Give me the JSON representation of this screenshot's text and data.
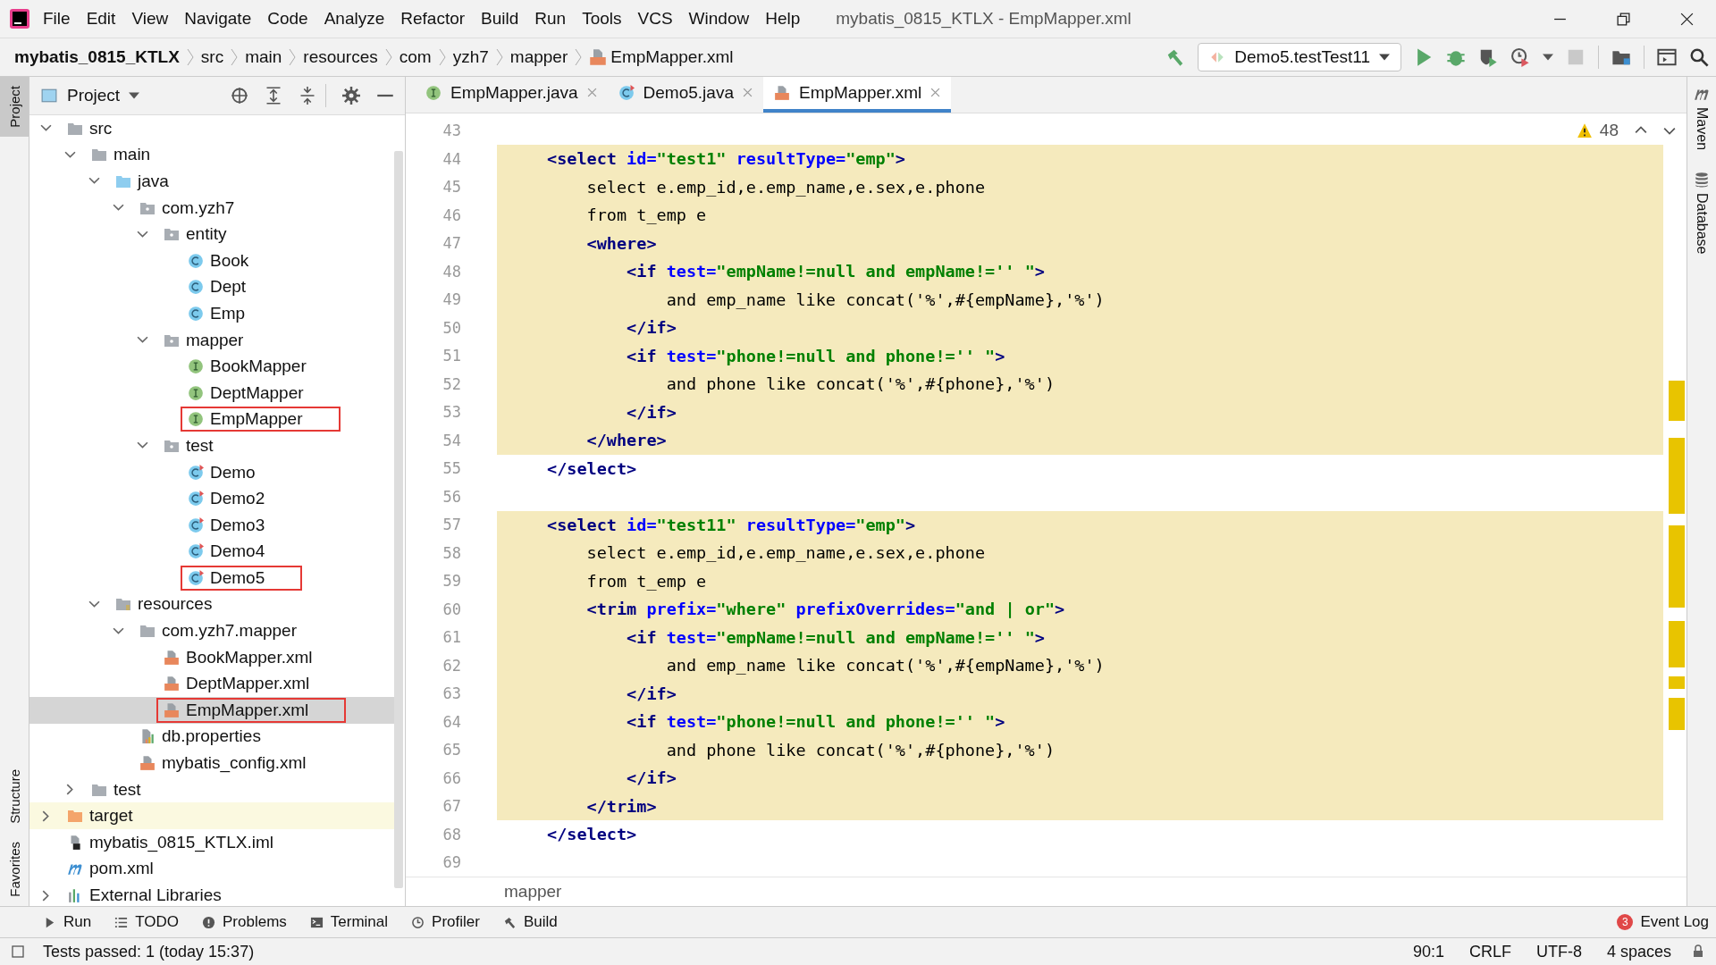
{
  "menu": [
    "File",
    "Edit",
    "View",
    "Navigate",
    "Code",
    "Analyze",
    "Refactor",
    "Build",
    "Run",
    "Tools",
    "VCS",
    "Window",
    "Help"
  ],
  "window": {
    "title": "mybatis_0815_KTLX - EmpMapper.xml"
  },
  "breadcrumbs": [
    {
      "label": "mybatis_0815_KTLX",
      "kind": "project"
    },
    {
      "label": "src",
      "kind": "dir"
    },
    {
      "label": "main",
      "kind": "dir"
    },
    {
      "label": "resources",
      "kind": "dir"
    },
    {
      "label": "com",
      "kind": "dir"
    },
    {
      "label": "yzh7",
      "kind": "dir"
    },
    {
      "label": "mapper",
      "kind": "dir"
    },
    {
      "label": "EmpMapper.xml",
      "kind": "xml"
    }
  ],
  "run_config": "Demo5.testTest11",
  "project_panel": {
    "title": "Project"
  },
  "tree": [
    {
      "label": "src",
      "kind": "folder",
      "expanded": true,
      "selected": false,
      "outlined": false,
      "children": [
        {
          "label": "main",
          "kind": "folder",
          "expanded": true,
          "selected": false,
          "outlined": false,
          "children": [
            {
              "label": "java",
              "kind": "source",
              "expanded": true,
              "selected": false,
              "outlined": false,
              "children": [
                {
                  "label": "com.yzh7",
                  "kind": "package",
                  "expanded": true,
                  "selected": false,
                  "outlined": false,
                  "children": [
                    {
                      "label": "entity",
                      "kind": "package",
                      "expanded": true,
                      "selected": false,
                      "outlined": false,
                      "children": [
                        {
                          "label": "Book",
                          "kind": "class",
                          "selected": false,
                          "outlined": false
                        },
                        {
                          "label": "Dept",
                          "kind": "class",
                          "selected": false,
                          "outlined": false
                        },
                        {
                          "label": "Emp",
                          "kind": "class",
                          "selected": false,
                          "outlined": false
                        }
                      ]
                    },
                    {
                      "label": "mapper",
                      "kind": "package",
                      "expanded": true,
                      "selected": false,
                      "outlined": false,
                      "children": [
                        {
                          "label": "BookMapper",
                          "kind": "interface",
                          "selected": false,
                          "outlined": false
                        },
                        {
                          "label": "DeptMapper",
                          "kind": "interface",
                          "selected": false,
                          "outlined": false
                        },
                        {
                          "label": "EmpMapper",
                          "kind": "interface",
                          "selected": false,
                          "outlined": true
                        }
                      ]
                    },
                    {
                      "label": "test",
                      "kind": "package",
                      "expanded": true,
                      "selected": false,
                      "outlined": false,
                      "children": [
                        {
                          "label": "Demo",
                          "kind": "testclass",
                          "selected": false,
                          "outlined": false
                        },
                        {
                          "label": "Demo2",
                          "kind": "testclass",
                          "selected": false,
                          "outlined": false
                        },
                        {
                          "label": "Demo3",
                          "kind": "testclass",
                          "selected": false,
                          "outlined": false
                        },
                        {
                          "label": "Demo4",
                          "kind": "testclass",
                          "selected": false,
                          "outlined": false
                        },
                        {
                          "label": "Demo5",
                          "kind": "testclass",
                          "selected": false,
                          "outlined": true
                        }
                      ]
                    }
                  ]
                }
              ]
            },
            {
              "label": "resources",
              "kind": "resources",
              "expanded": true,
              "selected": false,
              "outlined": false,
              "children": [
                {
                  "label": "com.yzh7.mapper",
                  "kind": "folder",
                  "expanded": true,
                  "selected": false,
                  "outlined": false,
                  "children": [
                    {
                      "label": "BookMapper.xml",
                      "kind": "xml",
                      "selected": false,
                      "outlined": false
                    },
                    {
                      "label": "DeptMapper.xml",
                      "kind": "xml",
                      "selected": false,
                      "outlined": false
                    },
                    {
                      "label": "EmpMapper.xml",
                      "kind": "xml",
                      "selected": true,
                      "outlined": true
                    }
                  ]
                },
                {
                  "label": "db.properties",
                  "kind": "properties",
                  "selected": false,
                  "outlined": false
                },
                {
                  "label": "mybatis_config.xml",
                  "kind": "xml",
                  "selected": false,
                  "outlined": false
                }
              ]
            }
          ]
        },
        {
          "label": "test",
          "kind": "folder",
          "expanded": false,
          "selected": false,
          "outlined": false
        }
      ]
    },
    {
      "label": "target",
      "kind": "excluded",
      "expanded": false,
      "selected": false,
      "outlined": false
    },
    {
      "label": "mybatis_0815_KTLX.iml",
      "kind": "iml",
      "selected": false,
      "outlined": false
    },
    {
      "label": "pom.xml",
      "kind": "maven",
      "selected": false,
      "outlined": false
    },
    {
      "label": "External Libraries",
      "kind": "libs",
      "expanded": false,
      "selected": false,
      "outlined": false
    }
  ],
  "tabs": [
    {
      "label": "EmpMapper.java",
      "kind": "interface",
      "selected": false
    },
    {
      "label": "Demo5.java",
      "kind": "testclass",
      "selected": false
    },
    {
      "label": "EmpMapper.xml",
      "kind": "xml",
      "selected": true
    }
  ],
  "warnings": "48",
  "code": [
    {
      "n": "43",
      "hl": false
    },
    {
      "n": "44",
      "hl": true,
      "t": [
        {
          "kind": "tag",
          "s": "<select"
        },
        {
          "kind": "attr",
          "s": " id="
        },
        {
          "kind": "str",
          "s": "\"test1\""
        },
        {
          "kind": "attr",
          "s": " resultType="
        },
        {
          "kind": "str",
          "s": "\"emp\""
        },
        {
          "kind": "tag",
          "s": ">"
        }
      ]
    },
    {
      "n": "45",
      "hl": true,
      "t": [
        {
          "kind": "text",
          "s": "    select e.emp_id,e.emp_name,e.sex,e.phone"
        }
      ]
    },
    {
      "n": "46",
      "hl": true,
      "t": [
        {
          "kind": "text",
          "s": "    from t_emp e"
        }
      ]
    },
    {
      "n": "47",
      "hl": true,
      "t": [
        {
          "kind": "tag",
          "s": "    <where>"
        }
      ]
    },
    {
      "n": "48",
      "hl": true,
      "t": [
        {
          "kind": "tag",
          "s": "        <if"
        },
        {
          "kind": "attr",
          "s": " test="
        },
        {
          "kind": "str",
          "s": "\"empName!=null and empName!='' \""
        },
        {
          "kind": "tag",
          "s": ">"
        }
      ]
    },
    {
      "n": "49",
      "hl": true,
      "t": [
        {
          "kind": "text",
          "s": "            and emp_name like concat('%',#{empName},'%')"
        }
      ]
    },
    {
      "n": "50",
      "hl": true,
      "t": [
        {
          "kind": "tag",
          "s": "        </if>"
        }
      ]
    },
    {
      "n": "51",
      "hl": true,
      "t": [
        {
          "kind": "tag",
          "s": "        <if"
        },
        {
          "kind": "attr",
          "s": " test="
        },
        {
          "kind": "str",
          "s": "\"phone!=null and phone!='' \""
        },
        {
          "kind": "tag",
          "s": ">"
        }
      ]
    },
    {
      "n": "52",
      "hl": true,
      "t": [
        {
          "kind": "text",
          "s": "            and phone like concat('%',#{phone},'%')"
        }
      ]
    },
    {
      "n": "53",
      "hl": true,
      "t": [
        {
          "kind": "tag",
          "s": "        </if>"
        }
      ]
    },
    {
      "n": "54",
      "hl": true,
      "t": [
        {
          "kind": "tag",
          "s": "    </where>"
        }
      ]
    },
    {
      "n": "55",
      "hl": false,
      "t": [
        {
          "kind": "tag",
          "s": "</select>"
        }
      ]
    },
    {
      "n": "56",
      "hl": false
    },
    {
      "n": "57",
      "hl": true,
      "t": [
        {
          "kind": "tag",
          "s": "<select"
        },
        {
          "kind": "attr",
          "s": " id="
        },
        {
          "kind": "str",
          "s": "\"test11\""
        },
        {
          "kind": "attr",
          "s": " resultType="
        },
        {
          "kind": "str",
          "s": "\"emp\""
        },
        {
          "kind": "tag",
          "s": ">"
        }
      ]
    },
    {
      "n": "58",
      "hl": true,
      "t": [
        {
          "kind": "text",
          "s": "    select e.emp_id,e.emp_name,e.sex,e.phone"
        }
      ]
    },
    {
      "n": "59",
      "hl": true,
      "t": [
        {
          "kind": "text",
          "s": "    from t_emp e"
        }
      ]
    },
    {
      "n": "60",
      "hl": true,
      "t": [
        {
          "kind": "tag",
          "s": "    <trim"
        },
        {
          "kind": "attr",
          "s": " prefix="
        },
        {
          "kind": "str",
          "s": "\"where\""
        },
        {
          "kind": "attr",
          "s": " prefixOverrides="
        },
        {
          "kind": "str",
          "s": "\"and | or\""
        },
        {
          "kind": "tag",
          "s": ">"
        }
      ]
    },
    {
      "n": "61",
      "hl": true,
      "t": [
        {
          "kind": "tag",
          "s": "        <if"
        },
        {
          "kind": "attr",
          "s": " test="
        },
        {
          "kind": "str",
          "s": "\"empName!=null and empName!='' \""
        },
        {
          "kind": "tag",
          "s": ">"
        }
      ]
    },
    {
      "n": "62",
      "hl": true,
      "t": [
        {
          "kind": "text",
          "s": "            and emp_name like concat('%',#{empName},'%')"
        }
      ]
    },
    {
      "n": "63",
      "hl": true,
      "t": [
        {
          "kind": "tag",
          "s": "        </if>"
        }
      ]
    },
    {
      "n": "64",
      "hl": true,
      "t": [
        {
          "kind": "tag",
          "s": "        <if"
        },
        {
          "kind": "attr",
          "s": " test="
        },
        {
          "kind": "str",
          "s": "\"phone!=null and phone!='' \""
        },
        {
          "kind": "tag",
          "s": ">"
        }
      ]
    },
    {
      "n": "65",
      "hl": true,
      "t": [
        {
          "kind": "text",
          "s": "            and phone like concat('%',#{phone},'%')"
        }
      ]
    },
    {
      "n": "66",
      "hl": true,
      "t": [
        {
          "kind": "tag",
          "s": "        </if>"
        }
      ]
    },
    {
      "n": "67",
      "hl": true,
      "t": [
        {
          "kind": "tag",
          "s": "    </trim>"
        }
      ]
    },
    {
      "n": "68",
      "hl": false,
      "t": [
        {
          "kind": "tag",
          "s": "</select>"
        }
      ]
    },
    {
      "n": "69",
      "hl": false
    }
  ],
  "editor_breadcrumb": "mapper",
  "left_stripe_top": [
    {
      "label": "Project",
      "selected": true
    }
  ],
  "left_stripe_bottom": [
    {
      "label": "Structure",
      "selected": false
    },
    {
      "label": "Favorites",
      "selected": false
    }
  ],
  "right_stripe": [
    {
      "label": "Maven",
      "kind": "maven"
    },
    {
      "label": "Database",
      "kind": "database"
    }
  ],
  "tool_tabs": [
    {
      "label": "Run",
      "kind": "run"
    },
    {
      "label": "TODO",
      "kind": "list"
    },
    {
      "label": "Problems",
      "kind": "problems"
    },
    {
      "label": "Terminal",
      "kind": "terminal"
    },
    {
      "label": "Profiler",
      "kind": "profiler"
    },
    {
      "label": "Build",
      "kind": "build"
    }
  ],
  "event_log": {
    "label": "Event Log",
    "count": "3"
  },
  "status_bar": {
    "message": "Tests passed: 1 (today 15:37)",
    "position": "90:1",
    "line_sep": "CRLF",
    "encoding": "UTF-8",
    "indent": "4 spaces"
  }
}
